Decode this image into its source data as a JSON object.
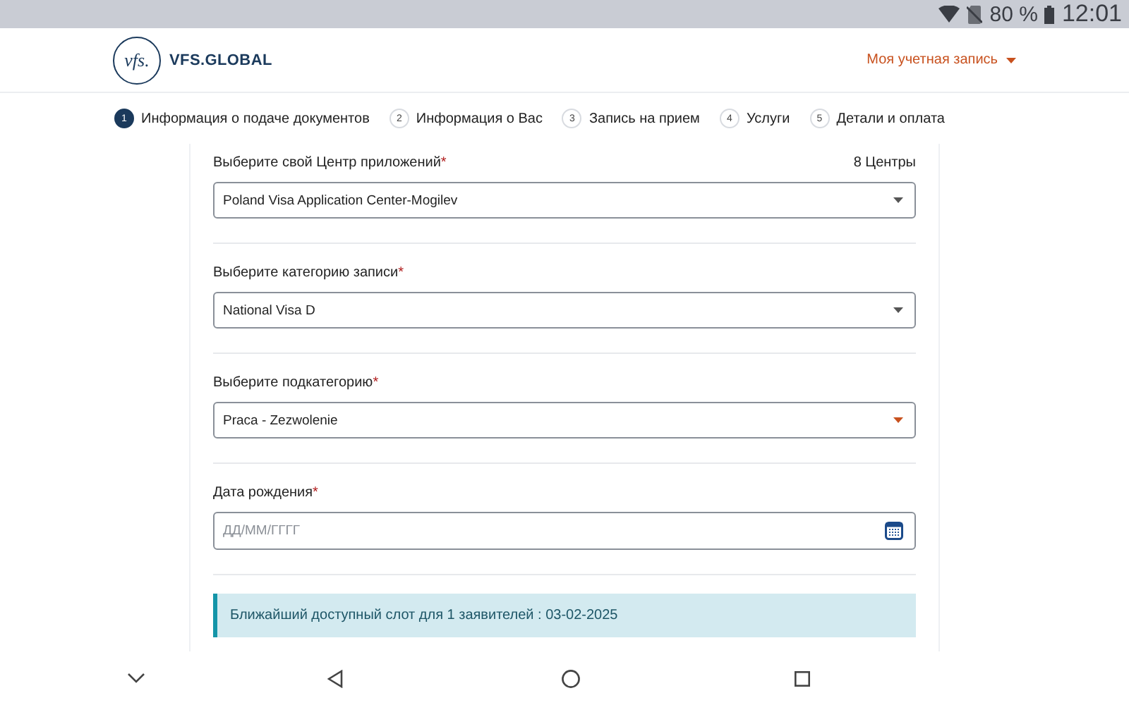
{
  "status_bar": {
    "battery": "80 %",
    "time": "12:01"
  },
  "header": {
    "logo_mark": "vfs.",
    "logo_text": "VFS.GLOBAL",
    "account_link": "Моя учетная запись"
  },
  "steps": [
    {
      "number": "1",
      "label": "Информация о подаче документов",
      "selected": true
    },
    {
      "number": "2",
      "label": "Информация о Вас",
      "selected": false
    },
    {
      "number": "3",
      "label": "Запись на прием",
      "selected": false
    },
    {
      "number": "4",
      "label": "Услуги",
      "selected": false
    },
    {
      "number": "5",
      "label": "Детали и оплата",
      "selected": false
    }
  ],
  "form": {
    "fields": [
      {
        "kind": "select",
        "label": "Выберите свой Центр приложений",
        "required_mark": "*",
        "count": "8 Центры",
        "value": "Poland Visa Application Center-Mogilev",
        "focused": false
      },
      {
        "kind": "select",
        "label": "Выберите категорию записи",
        "required_mark": "*",
        "value": "National Visa D",
        "focused": false
      },
      {
        "kind": "select",
        "label": "Выберите подкатегорию",
        "required_mark": "*",
        "value": "Praca - Zezwolenie",
        "focused": true
      },
      {
        "kind": "date",
        "label": "Дата рождения",
        "required_mark": "*",
        "placeholder": "ДД/ММ/ГГГГ"
      }
    ],
    "notice": "Ближайший доступный слот для 1 заявителей : 03-02-2025"
  }
}
